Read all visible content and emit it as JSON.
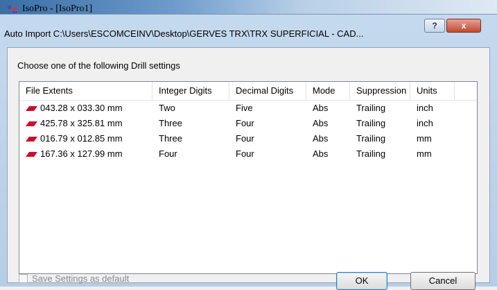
{
  "app": {
    "title": "IsoPro - [IsoPro1]"
  },
  "dialog": {
    "title": "Auto Import C:\\Users\\ESCOMCEINV\\Desktop\\GERVES TRX\\TRX SUPERFICIAL - CAD...",
    "help_label": "?",
    "close_label": "x",
    "prompt": "Choose one of the following Drill settings"
  },
  "list": {
    "columns": [
      "File Extents",
      "Integer Digits",
      "Decimal Digits",
      "Mode",
      "Suppression",
      "Units"
    ],
    "rows": [
      {
        "extents": "043.28 x 033.30 mm",
        "integer": "Two",
        "decimal": "Five",
        "mode": "Abs",
        "suppression": "Trailing",
        "units": "inch"
      },
      {
        "extents": "425.78 x 325.81 mm",
        "integer": "Three",
        "decimal": "Four",
        "mode": "Abs",
        "suppression": "Trailing",
        "units": "inch"
      },
      {
        "extents": "016.79 x 012.85 mm",
        "integer": "Three",
        "decimal": "Four",
        "mode": "Abs",
        "suppression": "Trailing",
        "units": "mm"
      },
      {
        "extents": "167.36 x 127.99 mm",
        "integer": "Four",
        "decimal": "Four",
        "mode": "Abs",
        "suppression": "Trailing",
        "units": "mm"
      }
    ],
    "row_icon": "layer-icon",
    "row_icon_color": "#c8102e"
  },
  "footer": {
    "save_default_label": "Save Settings as default",
    "ok_label": "OK",
    "cancel_label": "Cancel"
  }
}
